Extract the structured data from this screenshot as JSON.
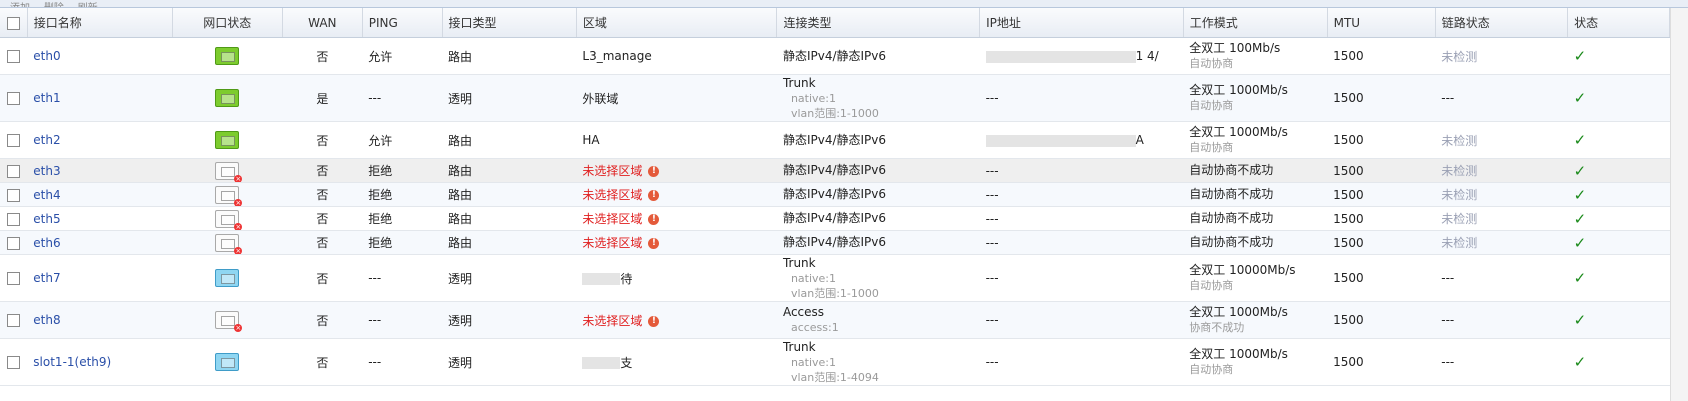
{
  "toolbar": {
    "items": [
      "添加",
      "删除",
      "刷新"
    ]
  },
  "columns": [
    "接口名称",
    "网口状态",
    "WAN",
    "PING",
    "接口类型",
    "区域",
    "连接类型",
    "IP地址",
    "工作模式",
    "MTU",
    "链路状态",
    "状态"
  ],
  "rows": [
    {
      "name": "eth0",
      "port": "green",
      "wan": "否",
      "ping": "允许",
      "type": "路由",
      "zone": "L3_manage",
      "zone_warn": false,
      "conn": "静态IPv4/静态IPv6",
      "conn_sub": [],
      "ip": "1 4/",
      "ip_masked": true,
      "mode": "全双工 100Mb/s",
      "mode_sub": "自动协商",
      "mtu": "1500",
      "link": "未检测",
      "status": "✓"
    },
    {
      "name": "eth1",
      "port": "green",
      "wan": "是",
      "ping": "---",
      "type": "透明",
      "zone": "外联域",
      "zone_warn": false,
      "conn": "Trunk",
      "conn_sub": [
        "native:1",
        "vlan范围:1-1000"
      ],
      "ip": "---",
      "ip_masked": false,
      "mode": "全双工 1000Mb/s",
      "mode_sub": "自动协商",
      "mtu": "1500",
      "link": "---",
      "status": "✓"
    },
    {
      "name": "eth2",
      "port": "green",
      "wan": "否",
      "ping": "允许",
      "type": "路由",
      "zone": "HA",
      "zone_warn": false,
      "conn": "静态IPv4/静态IPv6",
      "conn_sub": [],
      "ip": "A",
      "ip_masked": true,
      "mode": "全双工 1000Mb/s",
      "mode_sub": "自动协商",
      "mtu": "1500",
      "link": "未检测",
      "status": "✓"
    },
    {
      "name": "eth3",
      "port": "off",
      "wan": "否",
      "ping": "拒绝",
      "type": "路由",
      "zone": "未选择区域",
      "zone_warn": true,
      "conn": "静态IPv4/静态IPv6",
      "conn_sub": [],
      "ip": "---",
      "ip_masked": false,
      "mode": "自动协商不成功",
      "mode_sub": "",
      "mtu": "1500",
      "link": "未检测",
      "status": "✓"
    },
    {
      "name": "eth4",
      "port": "off",
      "wan": "否",
      "ping": "拒绝",
      "type": "路由",
      "zone": "未选择区域",
      "zone_warn": true,
      "conn": "静态IPv4/静态IPv6",
      "conn_sub": [],
      "ip": "---",
      "ip_masked": false,
      "mode": "自动协商不成功",
      "mode_sub": "",
      "mtu": "1500",
      "link": "未检测",
      "status": "✓"
    },
    {
      "name": "eth5",
      "port": "off",
      "wan": "否",
      "ping": "拒绝",
      "type": "路由",
      "zone": "未选择区域",
      "zone_warn": true,
      "conn": "静态IPv4/静态IPv6",
      "conn_sub": [],
      "ip": "---",
      "ip_masked": false,
      "mode": "自动协商不成功",
      "mode_sub": "",
      "mtu": "1500",
      "link": "未检测",
      "status": "✓"
    },
    {
      "name": "eth6",
      "port": "off",
      "wan": "否",
      "ping": "拒绝",
      "type": "路由",
      "zone": "未选择区域",
      "zone_warn": true,
      "conn": "静态IPv4/静态IPv6",
      "conn_sub": [],
      "ip": "---",
      "ip_masked": false,
      "mode": "自动协商不成功",
      "mode_sub": "",
      "mtu": "1500",
      "link": "未检测",
      "status": "✓"
    },
    {
      "name": "eth7",
      "port": "blue",
      "wan": "否",
      "ping": "---",
      "type": "透明",
      "zone": "待",
      "zone_warn": false,
      "zone_masked": true,
      "conn": "Trunk",
      "conn_sub": [
        "native:1",
        "vlan范围:1-1000"
      ],
      "ip": "---",
      "ip_masked": false,
      "mode": "全双工 10000Mb/s",
      "mode_sub": "自动协商",
      "mtu": "1500",
      "link": "---",
      "status": "✓"
    },
    {
      "name": "eth8",
      "port": "off-white",
      "wan": "否",
      "ping": "---",
      "type": "透明",
      "zone": "未选择区域",
      "zone_warn": true,
      "conn": "Access",
      "conn_sub": [
        "access:1"
      ],
      "ip": "---",
      "ip_masked": false,
      "mode": "全双工 1000Mb/s",
      "mode_sub": "协商不成功",
      "mtu": "1500",
      "link": "---",
      "status": "✓"
    },
    {
      "name": "slot1-1(eth9)",
      "port": "blue",
      "wan": "否",
      "ping": "---",
      "type": "透明",
      "zone": "支",
      "zone_warn": false,
      "zone_masked": true,
      "conn": "Trunk",
      "conn_sub": [
        "native:1",
        "vlan范围:1-4094"
      ],
      "ip": "---",
      "ip_masked": false,
      "mode": "全双工 1000Mb/s",
      "mode_sub": "自动协商",
      "mtu": "1500",
      "link": "---",
      "status": "✓"
    }
  ],
  "colors": {
    "link": "#2a4fa8",
    "warn": "#e02020",
    "ok": "#1a8a1a",
    "port_green": "#7dcc2e",
    "port_blue": "#8fd6f2"
  }
}
